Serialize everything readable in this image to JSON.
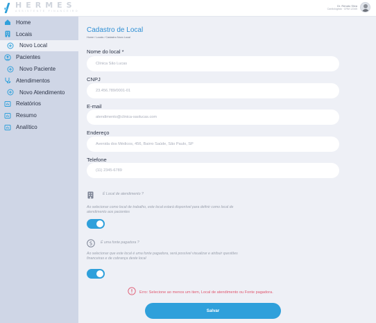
{
  "app": {
    "title": "HERMES",
    "subtitle": "ASSISTENTE FINANCEIRO"
  },
  "user": {
    "name": "Dr. Renato Silva",
    "role": "Cardiologista · CRM 12345"
  },
  "sidebar": {
    "items": [
      {
        "label": "Home",
        "icon": "home-icon"
      },
      {
        "label": "Locais",
        "icon": "building-icon"
      },
      {
        "label": "Novo Local",
        "icon": "plus-circle-icon"
      },
      {
        "label": "Pacientes",
        "icon": "user-circle-icon"
      },
      {
        "label": "Novo Paciente",
        "icon": "plus-circle-icon"
      },
      {
        "label": "Atendimentos",
        "icon": "stethoscope-icon"
      },
      {
        "label": "Novo Atendimento",
        "icon": "plus-circle-icon"
      },
      {
        "label": "Relatórios",
        "icon": "report-icon"
      },
      {
        "label": "Resumo",
        "icon": "report-icon"
      },
      {
        "label": "Analítico",
        "icon": "report-icon"
      }
    ]
  },
  "page": {
    "title": "Cadastro de Local",
    "breadcrumb": "Home / Locais / Cadastro Novo Local"
  },
  "form": {
    "nome": {
      "label": "Nome do local *",
      "placeholder": "Clínica São Lucas"
    },
    "cnpj": {
      "label": "CNPJ",
      "placeholder": "23.456.789/0001-01"
    },
    "email": {
      "label": "E-mail",
      "placeholder": "atendimento@clinica-saolucas.com"
    },
    "endereco": {
      "label": "Endereço",
      "placeholder": "Avenida dos Médicos, 456, Bairro Saúde, São Paulo, SP"
    },
    "telefone": {
      "label": "Telefone",
      "placeholder": "(11) 2345-6789"
    }
  },
  "options": {
    "atendimento": {
      "title": "É Local de atendimento ?",
      "description": "Ao selecionar como local de trabalho, este local estará disponível para definir como local de atendimento aos pacientes",
      "enabled": true
    },
    "pagadora": {
      "title": "É uma fonte pagadora ?",
      "description": "Ao selecionar que este local é uma fonte pagadora, será possível visualizar e atribuir questões financeiras e de cobrança deste local",
      "enabled": true
    }
  },
  "error": {
    "message": "Erro: Selecione ao menos um item, Local de atendimento ou Fonte pagadora."
  },
  "actions": {
    "save_label": "Salvar"
  },
  "colors": {
    "accent": "#2fa0db",
    "title": "#2e8fd4",
    "error": "#e0566e",
    "sidebar": "#cfd6e6",
    "background": "#eef0f6"
  }
}
